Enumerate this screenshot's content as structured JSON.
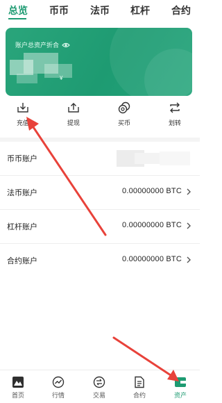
{
  "tabs": [
    {
      "label": "总览",
      "active": true
    },
    {
      "label": "币币",
      "active": false
    },
    {
      "label": "法币",
      "active": false
    },
    {
      "label": "杠杆",
      "active": false
    },
    {
      "label": "合约",
      "active": false
    }
  ],
  "card": {
    "label": "账户总资产折合",
    "eye_icon": "eye-icon",
    "unit": "¥",
    "color": "#1e9b72"
  },
  "actions": [
    {
      "label": "充值",
      "icon": "deposit-icon"
    },
    {
      "label": "提现",
      "icon": "withdraw-icon"
    },
    {
      "label": "买币",
      "icon": "buy-coin-icon"
    },
    {
      "label": "划转",
      "icon": "transfer-icon"
    }
  ],
  "accounts": [
    {
      "name": "币币账户",
      "value": ""
    },
    {
      "name": "法币账户",
      "value": "0.00000000 BTC"
    },
    {
      "name": "杠杆账户",
      "value": "0.00000000 BTC"
    },
    {
      "name": "合约账户",
      "value": "0.00000000 BTC"
    }
  ],
  "bottom_nav": [
    {
      "label": "首页",
      "icon": "home-icon",
      "active": false
    },
    {
      "label": "行情",
      "icon": "market-icon",
      "active": false
    },
    {
      "label": "交易",
      "icon": "trade-icon",
      "active": false
    },
    {
      "label": "合约",
      "icon": "contract-icon",
      "active": false
    },
    {
      "label": "资产",
      "icon": "assets-icon",
      "active": true
    }
  ],
  "colors": {
    "accent": "#1e9b72",
    "annotation_arrow": "#e8423a"
  }
}
